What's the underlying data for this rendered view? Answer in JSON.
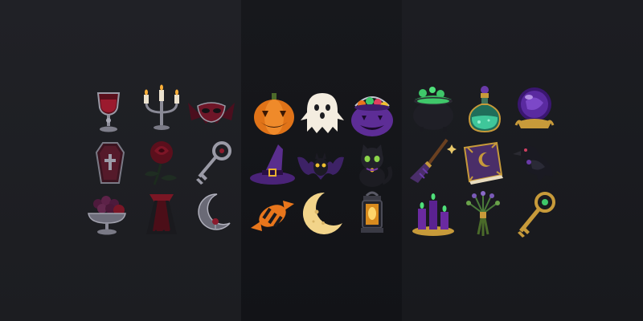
{
  "palette": {
    "left_panel": "#1f2024",
    "middle_panel": "#141519",
    "right_panel": "#1c1d21",
    "crimson": "#7a1424",
    "orange": "#e8761c",
    "purple": "#6a3aa8",
    "green": "#3fc76a",
    "gold": "#c79a3a"
  },
  "sets": [
    {
      "theme": "gothic",
      "icons": [
        "goblet-icon",
        "candelabra-icon",
        "bat-mask-icon",
        "coffin-icon",
        "rose-icon",
        "skeleton-key-icon",
        "grape-bowl-icon",
        "vampire-cape-icon",
        "crescent-moon-pendant-icon"
      ]
    },
    {
      "theme": "halloween",
      "icons": [
        "jack-o-lantern-icon",
        "ghost-icon",
        "candy-cauldron-icon",
        "witch-hat-icon",
        "bat-icon",
        "black-cat-icon",
        "wrapped-candy-icon",
        "crescent-moon-icon",
        "lantern-icon"
      ]
    },
    {
      "theme": "witchcraft",
      "icons": [
        "bubbling-cauldron-icon",
        "potion-bottle-icon",
        "crystal-ball-icon",
        "broomstick-icon",
        "spell-book-icon",
        "raven-icon",
        "ritual-candles-icon",
        "herb-bundle-icon",
        "golden-key-icon"
      ]
    }
  ]
}
